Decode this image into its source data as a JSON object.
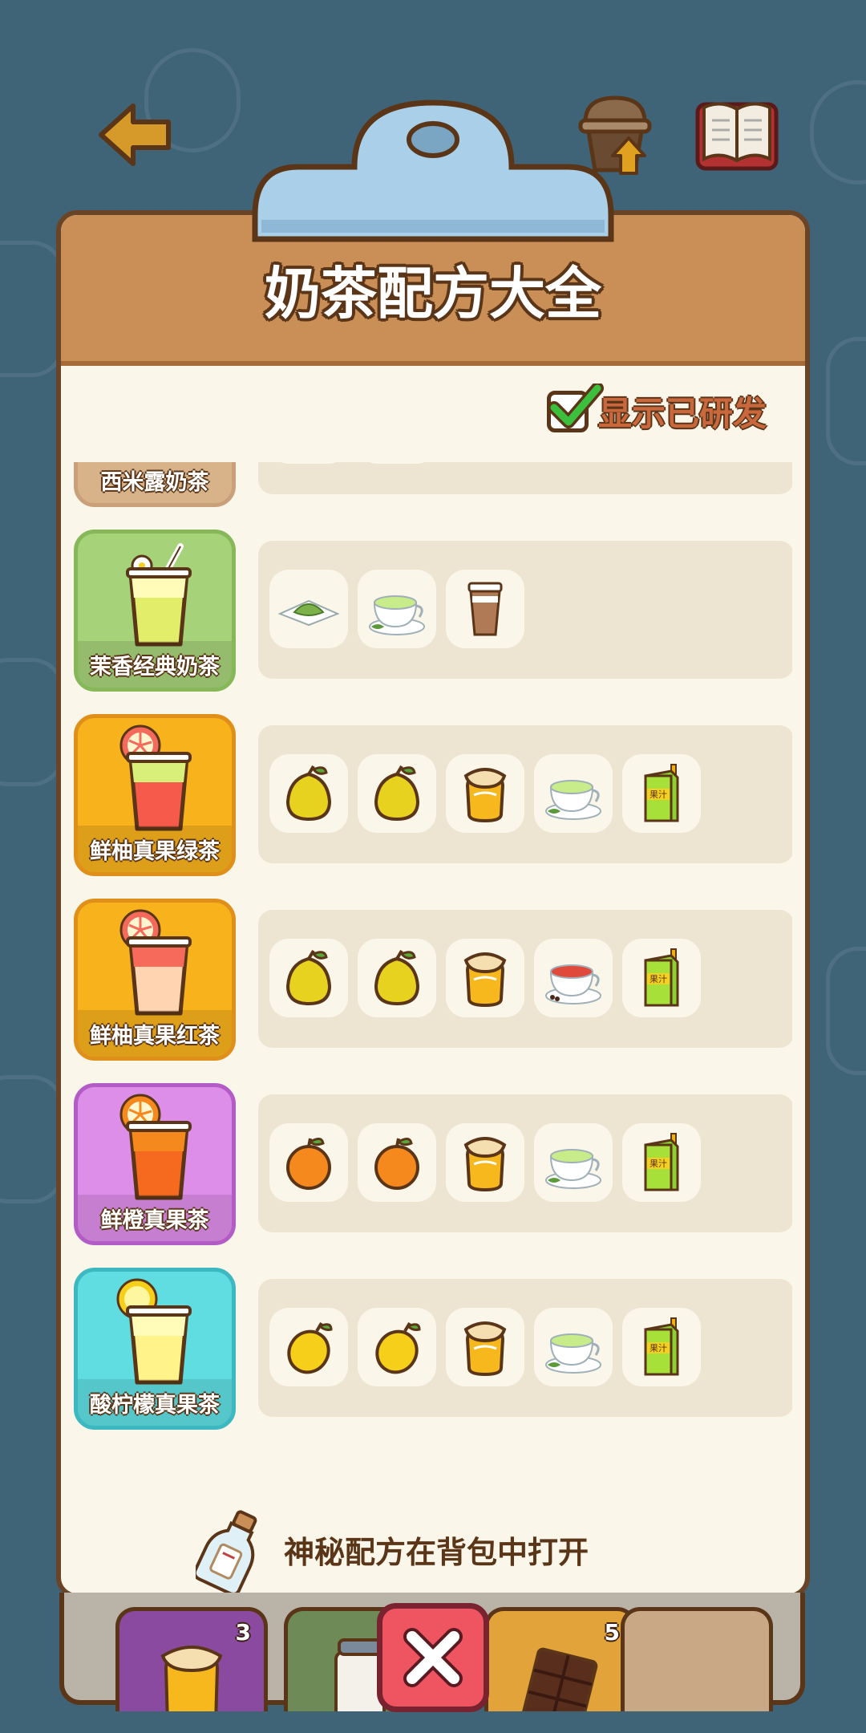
{
  "header": {
    "title": "奶茶配方大全",
    "back_icon": "back-arrow-icon",
    "upgrade_icon": "cup-upgrade-icon",
    "book_icon": "recipe-book-icon"
  },
  "toggle": {
    "label": "显示已研发",
    "checked": true
  },
  "recipes": [
    {
      "name": "西米露奶茶",
      "card_color": "#f1c89a",
      "ingredients": [
        "sago-icon",
        "milk-cup-icon"
      ]
    },
    {
      "name": "茉香经典奶茶",
      "card_color": "#a6d27a",
      "ingredients": [
        "matcha-powder-icon",
        "green-tea-cup-icon",
        "milk-cup-icon"
      ]
    },
    {
      "name": "鲜柚真果绿茶",
      "card_color": "#f7b21c",
      "ingredients": [
        "pomelo-icon",
        "pomelo-icon",
        "honey-jar-icon",
        "green-tea-cup-icon",
        "juice-box-icon"
      ]
    },
    {
      "name": "鲜柚真果红茶",
      "card_color": "#f7b21c",
      "ingredients": [
        "pomelo-icon",
        "pomelo-icon",
        "honey-jar-icon",
        "black-tea-cup-icon",
        "juice-box-icon"
      ]
    },
    {
      "name": "鲜橙真果茶",
      "card_color": "#dd8ee8",
      "ingredients": [
        "orange-icon",
        "orange-icon",
        "honey-jar-icon",
        "green-tea-cup-icon",
        "juice-box-icon"
      ]
    },
    {
      "name": "酸柠檬真果茶",
      "card_color": "#5fdde0",
      "ingredients": [
        "lemon-icon",
        "lemon-icon",
        "honey-jar-icon",
        "green-tea-cup-icon",
        "juice-box-icon"
      ]
    }
  ],
  "juice_box_label": "果汁",
  "footer": {
    "hint": "神秘配方在背包中打开",
    "icon": "message-bottle-icon"
  },
  "bag": [
    {
      "item": "honey-jar-icon",
      "count": "3",
      "color": "#8a4aa0"
    },
    {
      "item": "milk-jar-icon",
      "count": "",
      "color": "#6e8a56"
    },
    {
      "item": "chocolate-icon",
      "count": "5",
      "color": "#e2a43a"
    },
    {
      "item": "empty-slot",
      "count": "",
      "color": "#c9a985"
    }
  ],
  "close_icon": "close-x-icon"
}
